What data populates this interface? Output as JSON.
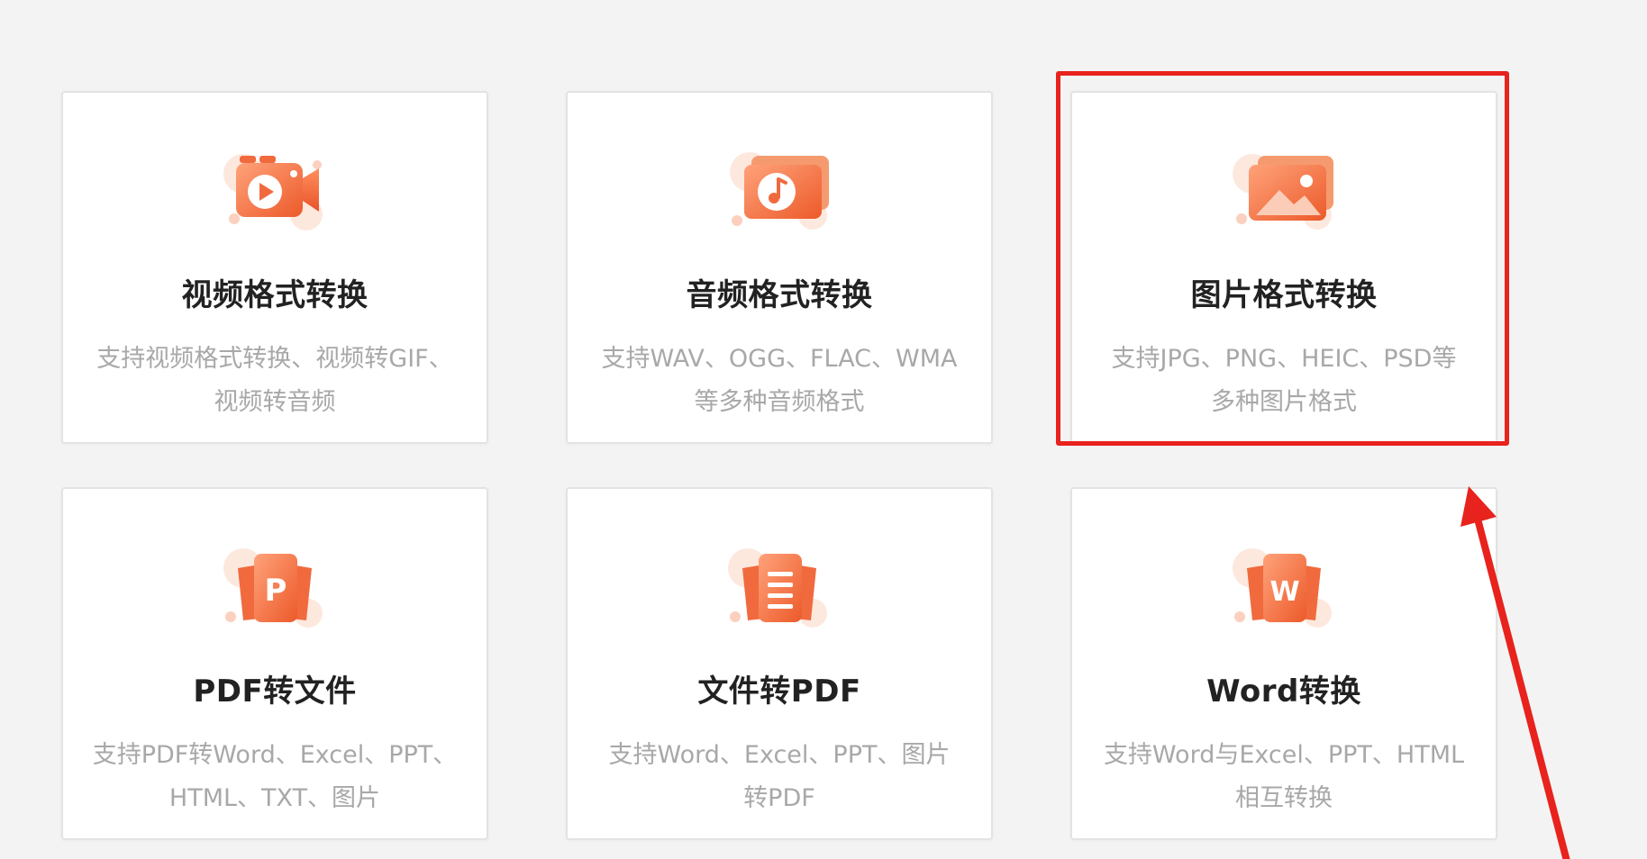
{
  "colors": {
    "accent": "#f06a3e",
    "accent_light": "#ff9a6b",
    "annotation_red": "#e8221d",
    "title_text": "#222222",
    "desc_text": "#a8a8a8"
  },
  "cards": [
    {
      "icon": "video-camera-icon",
      "title": "视频格式转换",
      "desc_line1": "支持视频格式转换、视频转GIF、",
      "desc_line2": "视频转音频"
    },
    {
      "icon": "music-note-icon",
      "title": "音频格式转换",
      "desc_line1": "支持WAV、OGG、FLAC、WMA",
      "desc_line2": "等多种音频格式"
    },
    {
      "icon": "image-icon",
      "title": "图片格式转换",
      "desc_line1": "支持JPG、PNG、HEIC、PSD等",
      "desc_line2": "多种图片格式"
    },
    {
      "icon": "pdf-p-icon",
      "title": "PDF转文件",
      "desc_line1": "支持PDF转Word、Excel、PPT、",
      "desc_line2": "HTML、TXT、图片"
    },
    {
      "icon": "document-lines-icon",
      "title": "文件转PDF",
      "desc_line1": "支持Word、Excel、PPT、图片",
      "desc_line2": "转PDF"
    },
    {
      "icon": "word-w-icon",
      "title": "Word转换",
      "desc_line1": "支持Word与Excel、PPT、HTML",
      "desc_line2": "相互转换"
    }
  ],
  "annotations": {
    "highlight_target": "图片格式转换",
    "arrow_icon": "red-arrow-icon"
  }
}
